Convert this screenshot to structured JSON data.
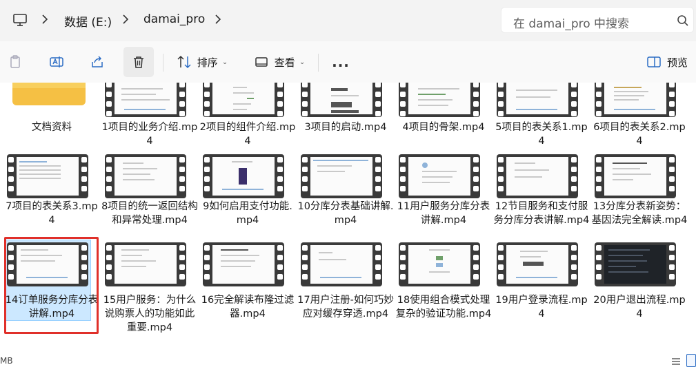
{
  "window": {
    "title": "damai_pro"
  },
  "breadcrumb": {
    "items": [
      "数据 (E:)",
      "damai_pro"
    ]
  },
  "search": {
    "placeholder": "在 damai_pro 中搜索"
  },
  "toolbar": {
    "sort_label": "排序",
    "view_label": "查看",
    "more_label": "...",
    "preview_label": "预览"
  },
  "files": [
    {
      "name": "文档资料",
      "type": "folder"
    },
    {
      "name": "1项目的业务介绍.mp4",
      "type": "video"
    },
    {
      "name": "2项目的组件介绍.mp4",
      "type": "video"
    },
    {
      "name": "3项目的启动.mp4",
      "type": "video"
    },
    {
      "name": "4项目的骨架.mp4",
      "type": "video"
    },
    {
      "name": "5项目的表关系1.mp4",
      "type": "video"
    },
    {
      "name": "6项目的表关系2.mp4",
      "type": "video"
    },
    {
      "name": "7项目的表关系3.mp4",
      "type": "video"
    },
    {
      "name": "8项目的统一返回结构和异常处理.mp4",
      "type": "video"
    },
    {
      "name": "9如何启用支付功能.mp4",
      "type": "video"
    },
    {
      "name": "10分库分表基础讲解.mp4",
      "type": "video"
    },
    {
      "name": "11用户服务分库分表讲解.mp4",
      "type": "video"
    },
    {
      "name": "12节目服务和支付服务分库分表讲解.mp4",
      "type": "video"
    },
    {
      "name": "13分库分表新姿势：基因法完全解读.mp4",
      "type": "video"
    },
    {
      "name": "14订单服务分库分表讲解.mp4",
      "type": "video",
      "selected": true
    },
    {
      "name": "15用户服务：为什么说购票人的功能如此重要.mp4",
      "type": "video"
    },
    {
      "name": "16完全解读布隆过滤器.mp4",
      "type": "video"
    },
    {
      "name": "17用户注册-如何巧妙应对缓存穿透.mp4",
      "type": "video"
    },
    {
      "name": "18使用组合模式处理复杂的验证功能.mp4",
      "type": "video"
    },
    {
      "name": "19用户登录流程.mp4",
      "type": "video"
    },
    {
      "name": "20用户退出流程.mp4",
      "type": "video"
    }
  ],
  "status": {
    "left_text": "MB"
  }
}
